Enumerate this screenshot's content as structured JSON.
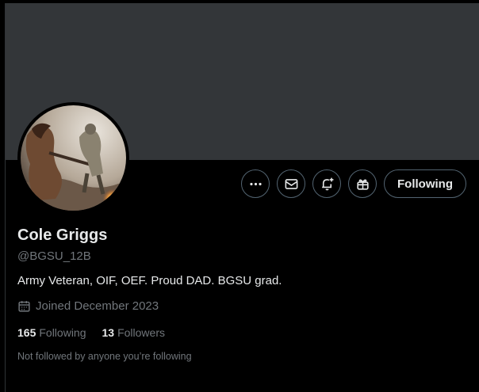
{
  "profile": {
    "name": "Cole Griggs",
    "handle": "@BGSU_12B",
    "bio": "Army Veteran, OIF, OEF. Proud DAD. BGSU grad.",
    "joined": "Joined December 2023",
    "following_count": "165",
    "following_label": "Following",
    "followers_count": "13",
    "followers_label": "Followers",
    "mutuals_note": "Not followed by anyone you’re following"
  },
  "actions": {
    "more_icon": "more-dots-icon",
    "message_icon": "mail-icon",
    "notify_icon": "bell-plus-icon",
    "subscribe_icon": "gift-icon",
    "follow_label": "Following"
  },
  "colors": {
    "background": "#000000",
    "banner": "#333639",
    "text_primary": "#e7e9ea",
    "text_secondary": "#71767b",
    "border": "#536471"
  }
}
